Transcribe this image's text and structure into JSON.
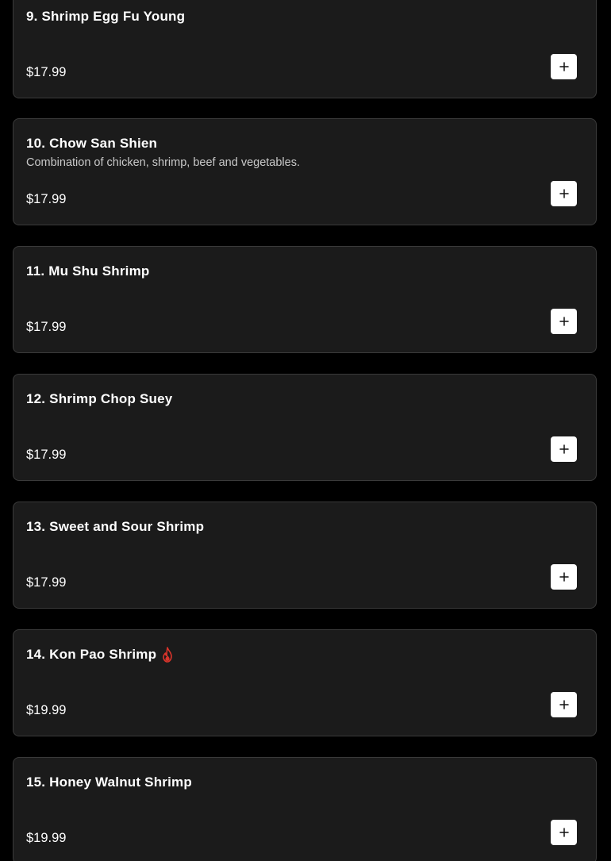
{
  "colors": {
    "page_background": "#000000",
    "card_background": "#1b1b1b",
    "card_border": "#3a3a3a",
    "title_text": "#ffffff",
    "description_text": "#c9c9c9",
    "add_button_background": "#ffffff",
    "add_button_icon": "#111111",
    "spicy_icon": "#d9342b"
  },
  "menu_items": [
    {
      "title": "9. Shrimp Egg Fu Young",
      "description": "",
      "price": "$17.99",
      "spicy": false,
      "add_icon": "plus-icon"
    },
    {
      "title": "10. Chow San Shien",
      "description": "Combination of chicken, shrimp, beef and vegetables.",
      "price": "$17.99",
      "spicy": false,
      "add_icon": "plus-icon"
    },
    {
      "title": "11. Mu Shu Shrimp",
      "description": "",
      "price": "$17.99",
      "spicy": false,
      "add_icon": "plus-icon"
    },
    {
      "title": "12. Shrimp Chop Suey",
      "description": "",
      "price": "$17.99",
      "spicy": false,
      "add_icon": "plus-icon"
    },
    {
      "title": "13. Sweet and Sour Shrimp",
      "description": "",
      "price": "$17.99",
      "spicy": false,
      "add_icon": "plus-icon"
    },
    {
      "title": "14. Kon Pao Shrimp",
      "description": "",
      "price": "$19.99",
      "spicy": true,
      "spicy_icon": "flame-icon",
      "add_icon": "plus-icon"
    },
    {
      "title": "15. Honey Walnut Shrimp",
      "description": "",
      "price": "$19.99",
      "spicy": false,
      "add_icon": "plus-icon"
    }
  ]
}
